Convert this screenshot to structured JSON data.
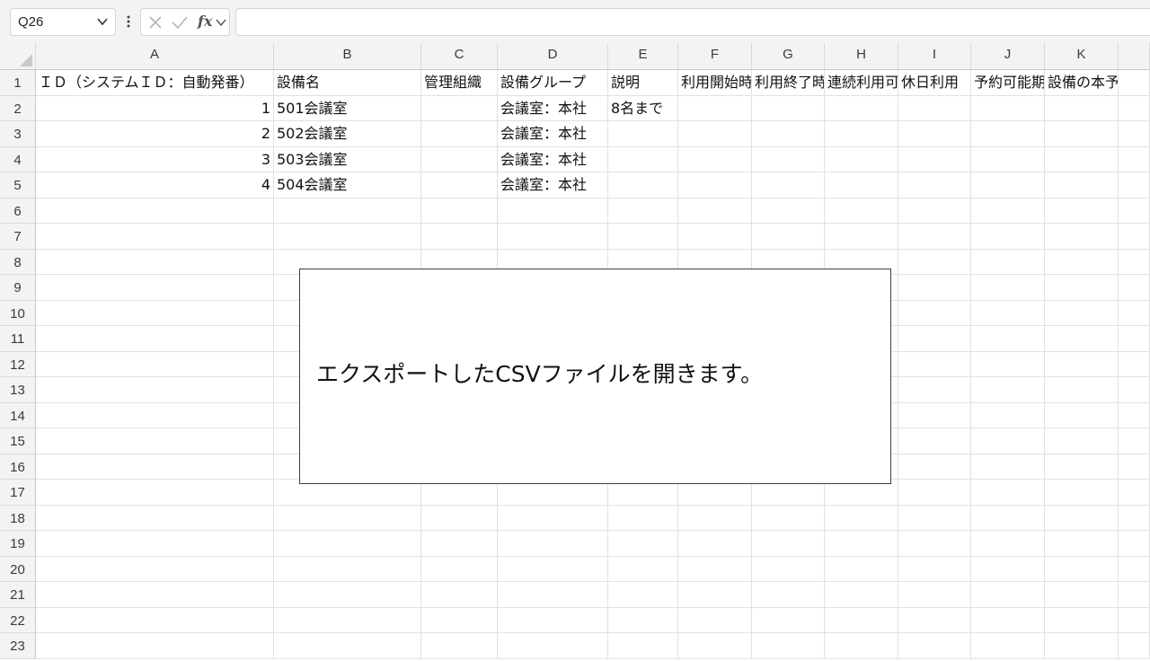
{
  "name_box": {
    "value": "Q26"
  },
  "formula_bar": {
    "fx_label": "fx",
    "value": ""
  },
  "columns": [
    "A",
    "B",
    "C",
    "D",
    "E",
    "F",
    "G",
    "H",
    "I",
    "J",
    "K"
  ],
  "row_numbers": [
    "1",
    "2",
    "3",
    "4",
    "5",
    "6",
    "7",
    "8",
    "9",
    "10",
    "11",
    "12",
    "13",
    "14",
    "15",
    "16",
    "17",
    "18",
    "19",
    "20",
    "21",
    "22",
    "23"
  ],
  "cells": [
    {
      "row": 1,
      "col": 0,
      "value": "ＩＤ（システムＩＤ：自動発番）"
    },
    {
      "row": 1,
      "col": 1,
      "value": "設備名"
    },
    {
      "row": 1,
      "col": 2,
      "value": "管理組織"
    },
    {
      "row": 1,
      "col": 3,
      "value": "設備グループ"
    },
    {
      "row": 1,
      "col": 4,
      "value": "説明"
    },
    {
      "row": 1,
      "col": 5,
      "value": "利用開始時"
    },
    {
      "row": 1,
      "col": 6,
      "value": "利用終了時"
    },
    {
      "row": 1,
      "col": 7,
      "value": "連続利用可"
    },
    {
      "row": 1,
      "col": 8,
      "value": "休日利用"
    },
    {
      "row": 1,
      "col": 9,
      "value": "予約可能期"
    },
    {
      "row": 1,
      "col": 10,
      "value": "設備の本予約"
    },
    {
      "row": 2,
      "col": 0,
      "value": "1",
      "num": true
    },
    {
      "row": 2,
      "col": 1,
      "value": "501会議室"
    },
    {
      "row": 2,
      "col": 3,
      "value": "会議室：本社"
    },
    {
      "row": 2,
      "col": 4,
      "value": "8名まで"
    },
    {
      "row": 3,
      "col": 0,
      "value": "2",
      "num": true
    },
    {
      "row": 3,
      "col": 1,
      "value": "502会議室"
    },
    {
      "row": 3,
      "col": 3,
      "value": "会議室：本社"
    },
    {
      "row": 4,
      "col": 0,
      "value": "3",
      "num": true
    },
    {
      "row": 4,
      "col": 1,
      "value": "503会議室"
    },
    {
      "row": 4,
      "col": 3,
      "value": "会議室：本社"
    },
    {
      "row": 5,
      "col": 0,
      "value": "4",
      "num": true
    },
    {
      "row": 5,
      "col": 1,
      "value": "504会議室"
    },
    {
      "row": 5,
      "col": 3,
      "value": "会議室：本社"
    }
  ],
  "callout": {
    "text": "エクスポートしたCSVファイルを開きます。"
  },
  "icons": {
    "name_box_dropdown": "chevron-down-icon",
    "more": "vertical-ellipsis-icon",
    "cancel": "x-icon",
    "enter": "check-icon",
    "function": "fx-icon",
    "fx_dropdown": "chevron-down-icon"
  },
  "colors": {
    "toolbar_bg": "#f3f3f3",
    "grid_line": "#e1e1e1",
    "header_bg": "#f3f3f3"
  }
}
